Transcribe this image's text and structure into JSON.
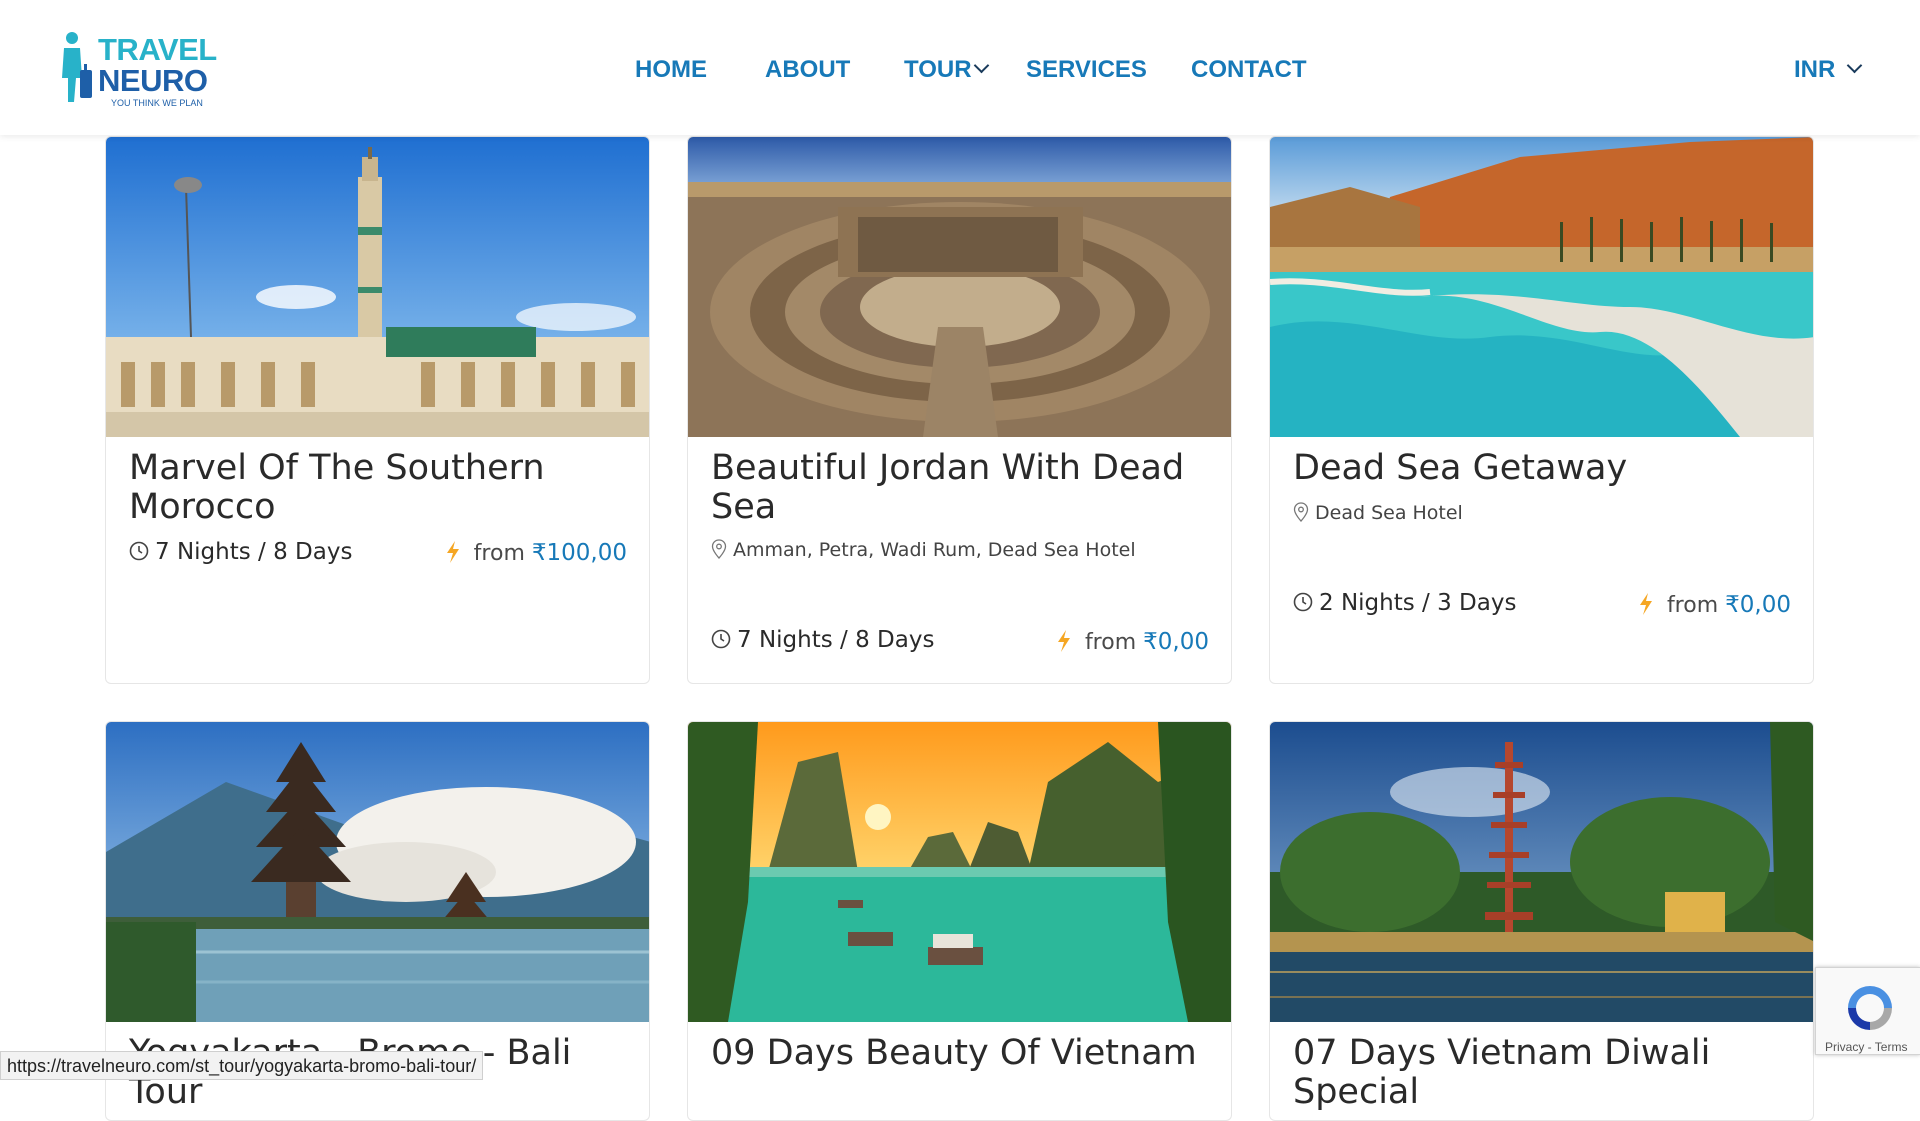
{
  "header": {
    "logo": {
      "line1": "TRAVEL",
      "line2": "NEURO",
      "tagline": "YOU THINK WE PLAN"
    },
    "nav": [
      {
        "label": "HOME"
      },
      {
        "label": "ABOUT"
      },
      {
        "label": "TOUR"
      },
      {
        "label": "SERVICES"
      },
      {
        "label": "CONTACT"
      }
    ],
    "currency": "INR"
  },
  "tours": [
    {
      "title": "Marvel Of The Southern Morocco",
      "location": "",
      "duration": "7 Nights / 8 Days",
      "from_label": "from",
      "price": "₹100,00",
      "image": "casablanca-mosque"
    },
    {
      "title": "Beautiful Jordan With Dead Sea",
      "location": "Amman, Petra, Wadi Rum, Dead Sea Hotel",
      "duration": "7 Nights / 8 Days",
      "from_label": "from",
      "price": "₹0,00",
      "image": "jerash-theater"
    },
    {
      "title": "Dead Sea Getaway",
      "location": "Dead Sea Hotel",
      "duration": "2 Nights / 3 Days",
      "from_label": "from",
      "price": "₹0,00",
      "image": "dead-sea-salt-pools"
    },
    {
      "title": "Yogyakarta - Bromo - Bali Tour",
      "image": "bali-temple-lake"
    },
    {
      "title": "09 Days Beauty Of Vietnam",
      "image": "halong-bay-sunset"
    },
    {
      "title": "07 Days Vietnam Diwali Special",
      "image": "hanoi-pagoda-night"
    }
  ],
  "status_bar": {
    "url": "https://travelneuro.com/st_tour/yogyakarta-bromo-bali-tour/"
  },
  "recaptcha": {
    "text": "Privacy - Terms"
  },
  "colors": {
    "nav": "#1779b8",
    "price": "#1779b8",
    "bolt": "#f5a623",
    "logo_teal": "#28b2c9",
    "logo_blue": "#1e5fa8"
  }
}
